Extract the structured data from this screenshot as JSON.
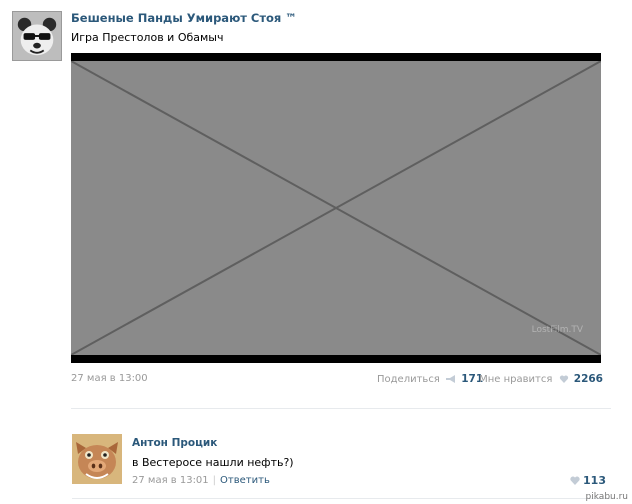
{
  "post": {
    "group_name": "Бешеные Панды Умирают Стоя ™",
    "text": "Игра Престолов и Обамыч",
    "date": "27 мая в 13:00",
    "share_label": "Поделиться",
    "share_count": "171",
    "like_label": "Мне нравится",
    "like_count": "2266",
    "media_watermark": "LostFilm.TV"
  },
  "comment": {
    "author": "Антон Процик",
    "text": "в Вестеросе нашли нефть?)",
    "date": "27 мая в 13:01",
    "separator": "|",
    "reply_label": "Ответить",
    "like_count": "113"
  },
  "watermark": "pikabu.ru",
  "icons": {
    "share": "megaphone-icon",
    "like": "heart-icon"
  },
  "colors": {
    "link": "#2b587a",
    "muted": "#999999",
    "divider": "#e7eaed"
  }
}
